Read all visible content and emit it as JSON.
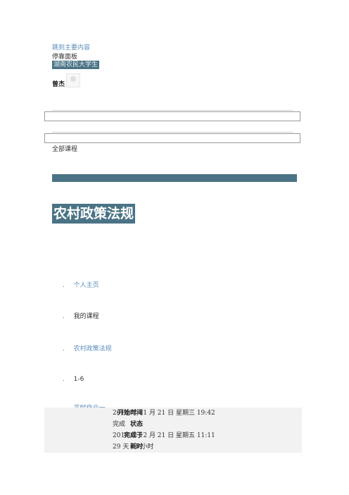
{
  "top_links": {
    "skip_to_content": "跳到主要内容",
    "dock_panel": "停靠面板",
    "university": "湖南农民大学生"
  },
  "user": {
    "name": "曾杰"
  },
  "all_courses": "全部课程",
  "course": {
    "title": "农村政策法规"
  },
  "breadcrumb": [
    {
      "dot": ".",
      "label": "个人主页",
      "link": true
    },
    {
      "dot": ".",
      "label": "我的课程",
      "link": false
    },
    {
      "dot": ".",
      "label": "农村政策法规",
      "link": true
    },
    {
      "dot": ".",
      "label": "1-6",
      "link": false
    },
    {
      "dot": ".",
      "label": "平时作业一",
      "link": true
    }
  ],
  "summary": {
    "rows": [
      {
        "label": "开始时间",
        "value": "2018 年 11 月 21 日 星期三 19:42"
      },
      {
        "label": "状态",
        "value": "完成"
      },
      {
        "label": "完成于",
        "value": "2018 年 12 月 21 日 星期五 11:11"
      },
      {
        "label": "耗时",
        "value": "29 天 15 小时"
      }
    ]
  },
  "colors": {
    "accent": "#4a7385",
    "link": "#5b8db8",
    "summary_bg": "#f2f2f2"
  }
}
